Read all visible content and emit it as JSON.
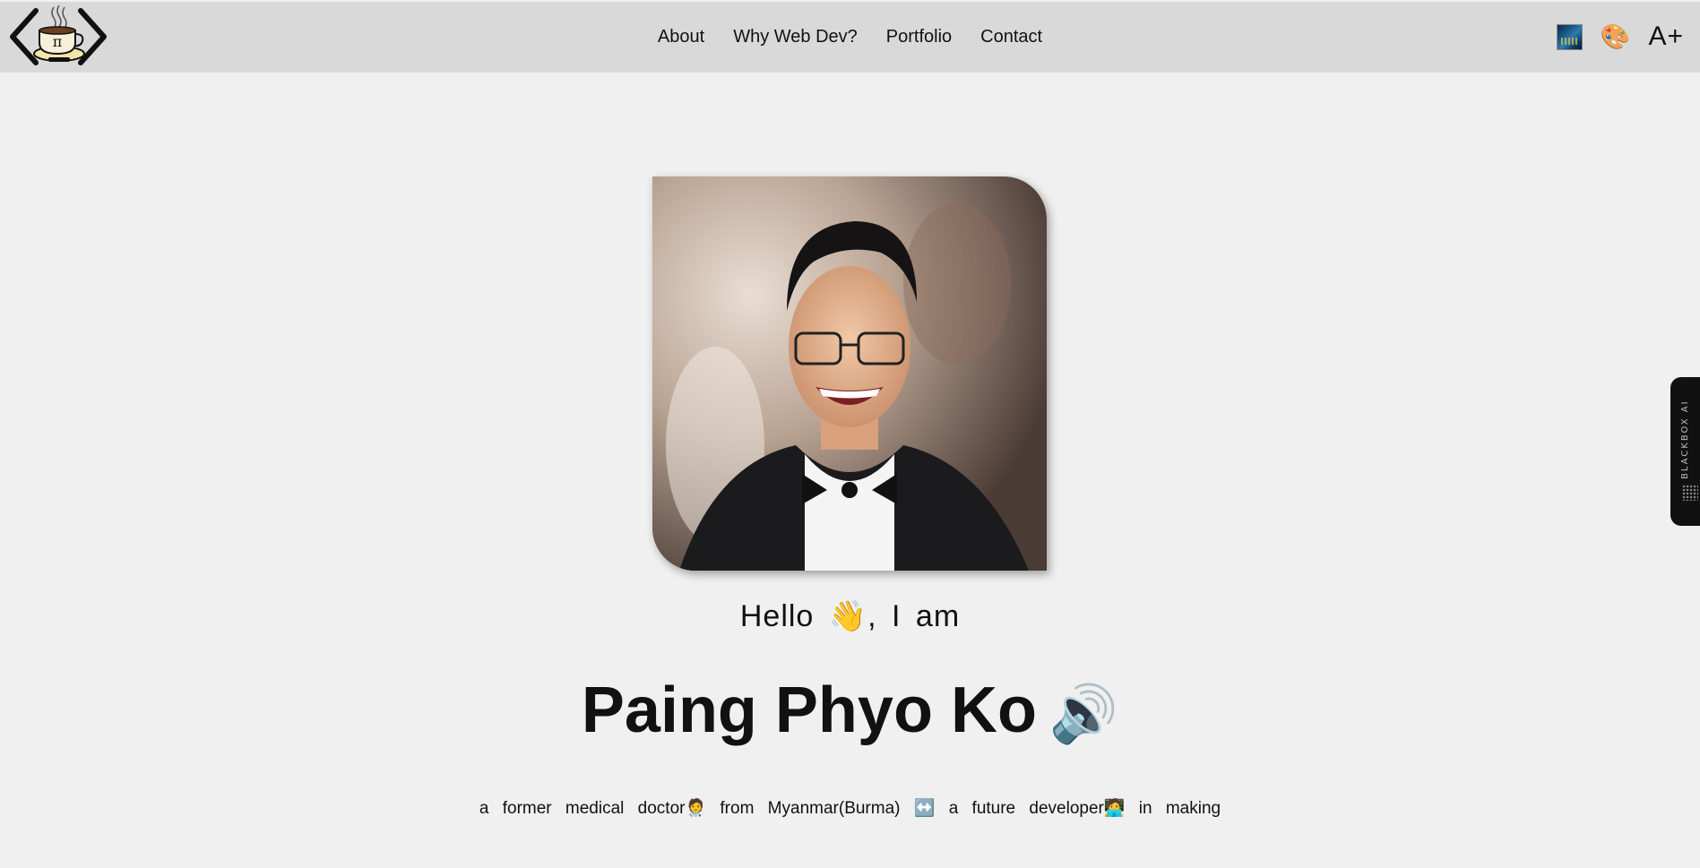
{
  "header": {
    "logo_icon": "coffee-pi-code-logo",
    "nav": [
      {
        "label": "About"
      },
      {
        "label": "Why Web Dev?"
      },
      {
        "label": "Portfolio"
      },
      {
        "label": "Contact"
      }
    ],
    "tools": {
      "theme_icon": "starry-night-theme-icon",
      "palette_icon": "palette-icon",
      "font_size_label": "A+"
    }
  },
  "hero": {
    "photo_description_icon": "profile-photo",
    "greeting": "Hello 👋, I am",
    "name": "Paing Phyo Ko",
    "speaker_icon": "speaker-icon",
    "speaker_glyph": "🔊",
    "tagline": "a former medical doctor🧑‍⚕️ from Myanmar(Burma) ↔️ a future developer🧑‍💻 in making"
  },
  "side_tab": {
    "label": "BLACKBOX AI"
  },
  "colors": {
    "page_bg": "#f0f0f0",
    "header_bg": "#d9d9d9",
    "side_tab_bg": "#111111"
  }
}
